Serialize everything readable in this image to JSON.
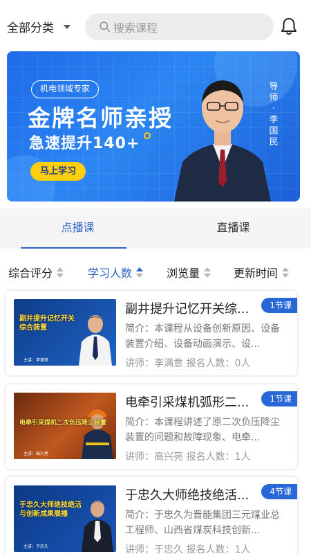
{
  "header": {
    "category_label": "全部分类",
    "search_placeholder": "搜索课程"
  },
  "banner": {
    "tag": "机电领域专家",
    "title": "金牌名师亲授",
    "subtitle": "急速提升140+",
    "button": "马上学习",
    "teacher_vertical": "导\n师\n·\n李\n国\n民",
    "accent_color": "#ffcf0f"
  },
  "tabs": [
    {
      "label": "点播课",
      "active": true
    },
    {
      "label": "直播课",
      "active": false
    }
  ],
  "sorts": [
    {
      "label": "综合评分"
    },
    {
      "label": "学习人数"
    },
    {
      "label": "浏览量"
    },
    {
      "label": "更新时间"
    }
  ],
  "courses": [
    {
      "title": "副井提升记忆开关综...",
      "badge": "1节课",
      "desc": "简介：本课程从设备创新原因、设备装置介绍、设备动画演示、设...",
      "meta": "讲师：李满意 报名人数：0人",
      "thumb_caption": "副井提升记忆开关\n综合装置",
      "thumb_speaker": "主讲：李满意"
    },
    {
      "title": "电牵引采煤机弧形二...",
      "badge": "1节课",
      "desc": "简介：本课程讲述了原二次负压降尘装置的问题和故障现象、电牵...",
      "meta": "讲师：高兴亮 报名人数：1人",
      "thumb_caption": "电牵引采煤机二次负压降尘装置",
      "thumb_speaker": "主讲：高兴亮"
    },
    {
      "title": "于忠久大师绝技绝活...",
      "badge": "4节课",
      "desc": "简介：于忠久为晋能集团三元煤业总工程师、山西省煤炭科技创新...",
      "meta": "讲师：于忠久 报名人数：1人",
      "thumb_caption": "于忠久大师绝技绝活\n与创新成果展播",
      "thumb_speaker": "主讲：于忠久"
    }
  ]
}
